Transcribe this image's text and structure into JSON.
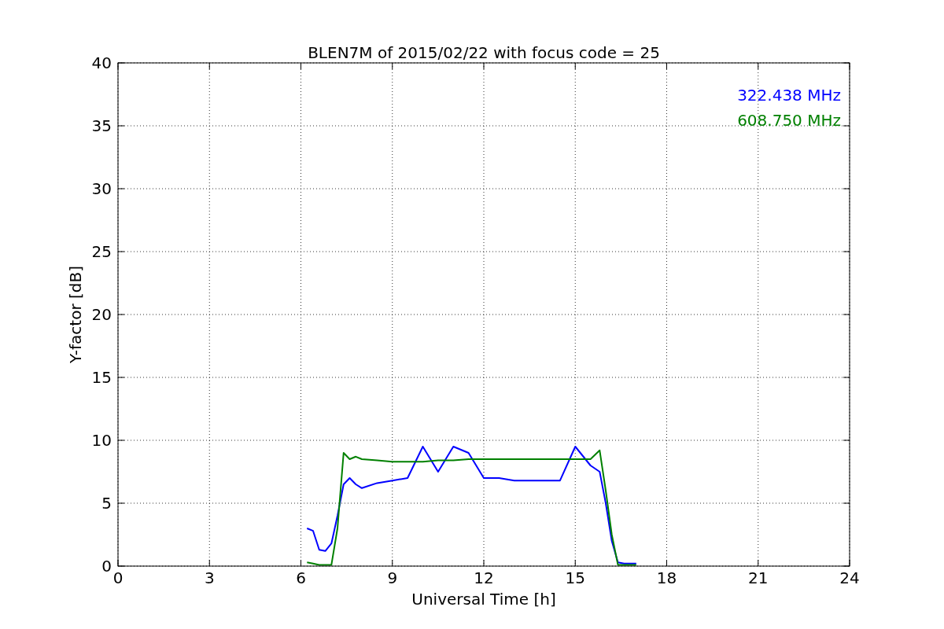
{
  "chart_data": {
    "type": "line",
    "title": "BLEN7M of 2015/02/22 with focus code = 25",
    "xlabel": "Universal Time [h]",
    "ylabel": "Y-factor [dB]",
    "x": [
      6.2,
      6.4,
      6.6,
      6.8,
      7.0,
      7.2,
      7.4,
      7.6,
      7.8,
      8.0,
      8.5,
      9.0,
      9.5,
      10.0,
      10.5,
      11.0,
      11.5,
      12.0,
      12.5,
      13.0,
      13.5,
      14.0,
      14.5,
      15.0,
      15.5,
      15.8,
      16.0,
      16.2,
      16.4,
      16.6,
      17.0
    ],
    "series": [
      {
        "name": "322.438 MHz",
        "color": "#0000ff",
        "values": [
          3.0,
          2.8,
          1.3,
          1.2,
          1.8,
          4.0,
          6.5,
          7.0,
          6.5,
          6.2,
          6.6,
          6.8,
          7.0,
          9.5,
          7.5,
          9.5,
          9.0,
          7.0,
          7.0,
          6.8,
          6.8,
          6.8,
          6.8,
          9.5,
          8.0,
          7.5,
          5.0,
          2.0,
          0.3,
          0.2,
          0.2
        ]
      },
      {
        "name": "608.750 MHz",
        "color": "#008000",
        "values": [
          0.3,
          0.2,
          0.1,
          0.1,
          0.1,
          3.0,
          9.0,
          8.5,
          8.7,
          8.5,
          8.4,
          8.3,
          8.3,
          8.3,
          8.4,
          8.4,
          8.5,
          8.5,
          8.5,
          8.5,
          8.5,
          8.5,
          8.5,
          8.5,
          8.5,
          9.2,
          6.0,
          2.5,
          0.1,
          0.1,
          0.1
        ]
      }
    ],
    "xlim": [
      0,
      24
    ],
    "ylim": [
      0,
      40
    ],
    "xticks": [
      0,
      3,
      6,
      9,
      12,
      15,
      18,
      21,
      24
    ],
    "yticks": [
      0,
      5,
      10,
      15,
      20,
      25,
      30,
      35,
      40
    ],
    "grid": true
  }
}
